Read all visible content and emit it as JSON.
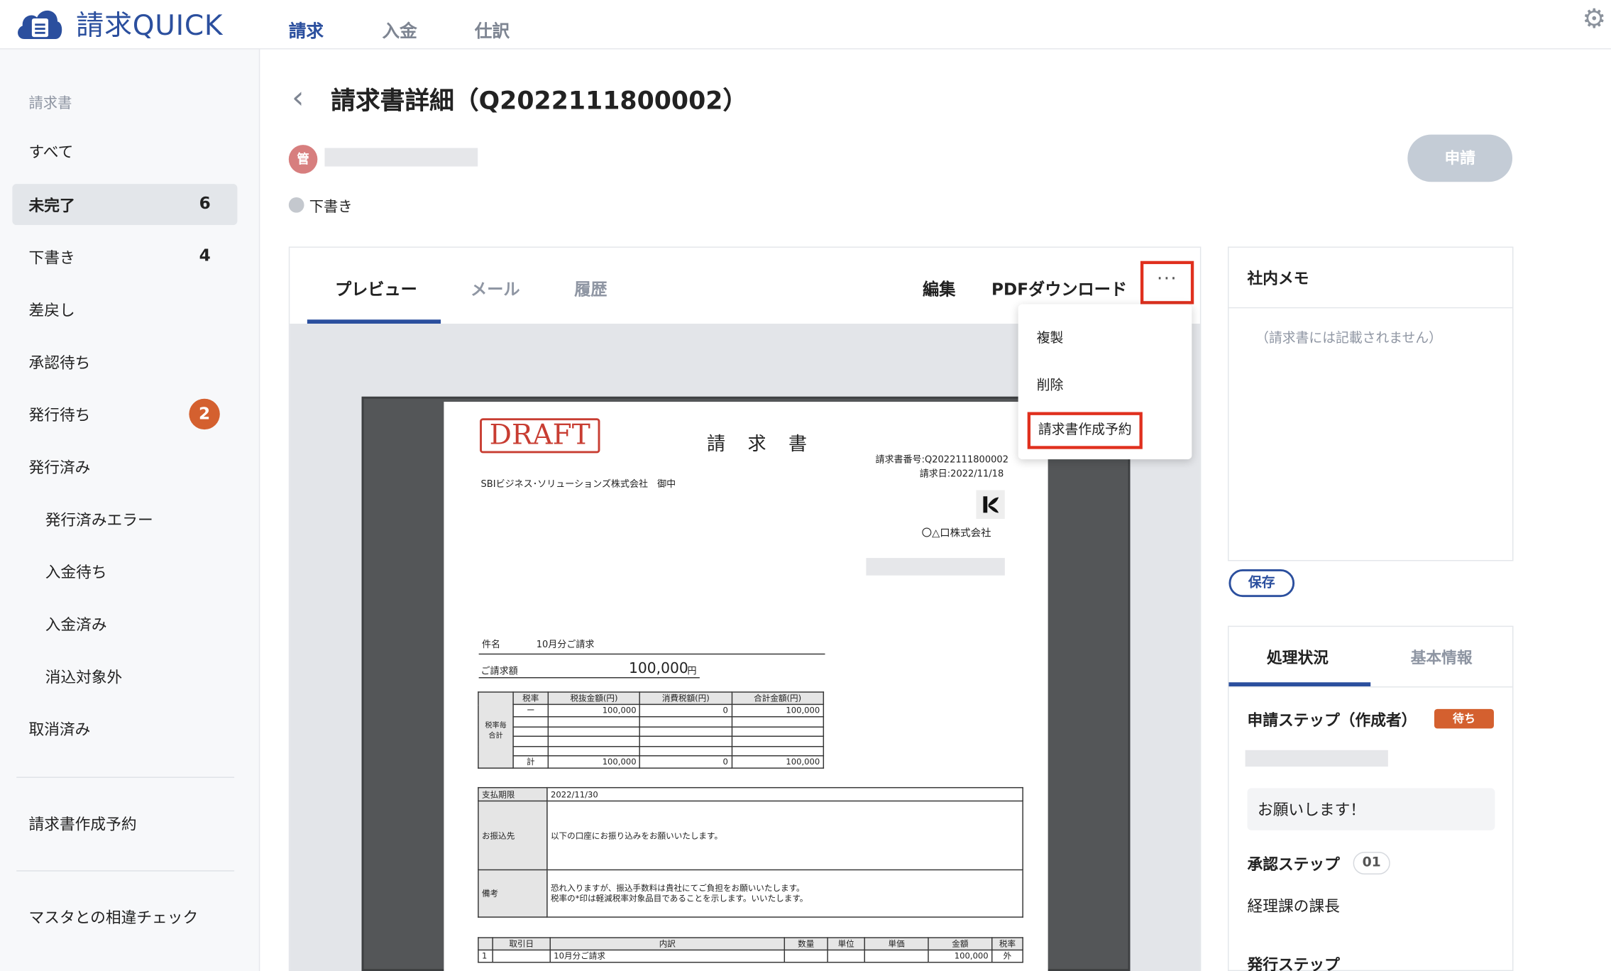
{
  "header": {
    "app_name": "請求QUICK",
    "nav": [
      "請求",
      "入金",
      "仕訳"
    ],
    "settings_icon": "gear-icon"
  },
  "sidebar": {
    "section_title": "請求書",
    "items": [
      {
        "label": "すべて",
        "count": ""
      },
      {
        "label": "未完了",
        "count": "6"
      },
      {
        "label": "下書き",
        "count": "4"
      },
      {
        "label": "差戻し",
        "count": ""
      },
      {
        "label": "承認待ち",
        "count": ""
      },
      {
        "label": "発行待ち",
        "count": "2"
      },
      {
        "label": "発行済み",
        "count": ""
      },
      {
        "label": "発行済みエラー",
        "count": ""
      },
      {
        "label": "入金待ち",
        "count": ""
      },
      {
        "label": "入金済み",
        "count": ""
      },
      {
        "label": "消込対象外",
        "count": ""
      },
      {
        "label": "取消済み",
        "count": ""
      }
    ],
    "scheduled": "請求書作成予約",
    "master_check": "マスタとの相違チェック"
  },
  "detail": {
    "title": "請求書詳細（Q2022111800002）",
    "avatar_text": "管",
    "status": "下書き",
    "apply_button": "申請"
  },
  "tabs": [
    "プレビュー",
    "メール",
    "履歴"
  ],
  "actions": {
    "edit": "編集",
    "pdf": "PDFダウンロード",
    "more": "···"
  },
  "menu": {
    "items": [
      "複製",
      "削除",
      "請求書作成予約"
    ]
  },
  "invoice": {
    "stamp": "DRAFT",
    "doc_title": "請 求 書",
    "number_line": "請求書番号:Q2022111800002",
    "date_line": "請求日:2022/11/18",
    "recipient": "SBIビジネス･ソリューションズ株式会社　御中",
    "sender": "〇△口株式会社",
    "subject_label": "件名",
    "subject": "10月分ご請求",
    "amount_label": "ご請求額",
    "amount": "100,000",
    "amount_unit": "円",
    "tax_headers": [
      "税率",
      "税抜金額(円)",
      "消費税額(円)",
      "合計金額(円)"
    ],
    "tax_row1": [
      "ー",
      "100,000",
      "0",
      "100,000"
    ],
    "tax_total": [
      "計",
      "100,000",
      "0",
      "100,000"
    ],
    "tax_side_label": "税率毎合計",
    "due_label": "支払期限",
    "due": "2022/11/30",
    "bank_label": "お振込先",
    "bank_text": "以下の口座にお振り込みをお願いいたします。",
    "note_label": "備考",
    "note_line1": "恐れ入りますが、振込手数料は貴社にてご負担をお願いいたします。",
    "note_line2": "税率の*印は軽減税率対象品目であることを示します。いいたします。",
    "item_headers": [
      "取引日",
      "内訳",
      "数量",
      "単位",
      "単価",
      "金額",
      "税率"
    ],
    "item_row": [
      "1",
      "",
      "10月分ご請求",
      "",
      "",
      "",
      "100,000",
      "外"
    ]
  },
  "memo": {
    "title": "社内メモ",
    "placeholder": "（請求書には記載されません）",
    "save": "保存"
  },
  "process": {
    "tabs": [
      "処理状況",
      "基本情報"
    ],
    "apply_step": "申請ステップ（作成者）",
    "wait_badge": "待ち",
    "comment": "お願いします！",
    "approve_step": "承認ステップ",
    "approve_num": "01",
    "approver": "経理課の課長",
    "issue_step": "発行ステップ"
  }
}
